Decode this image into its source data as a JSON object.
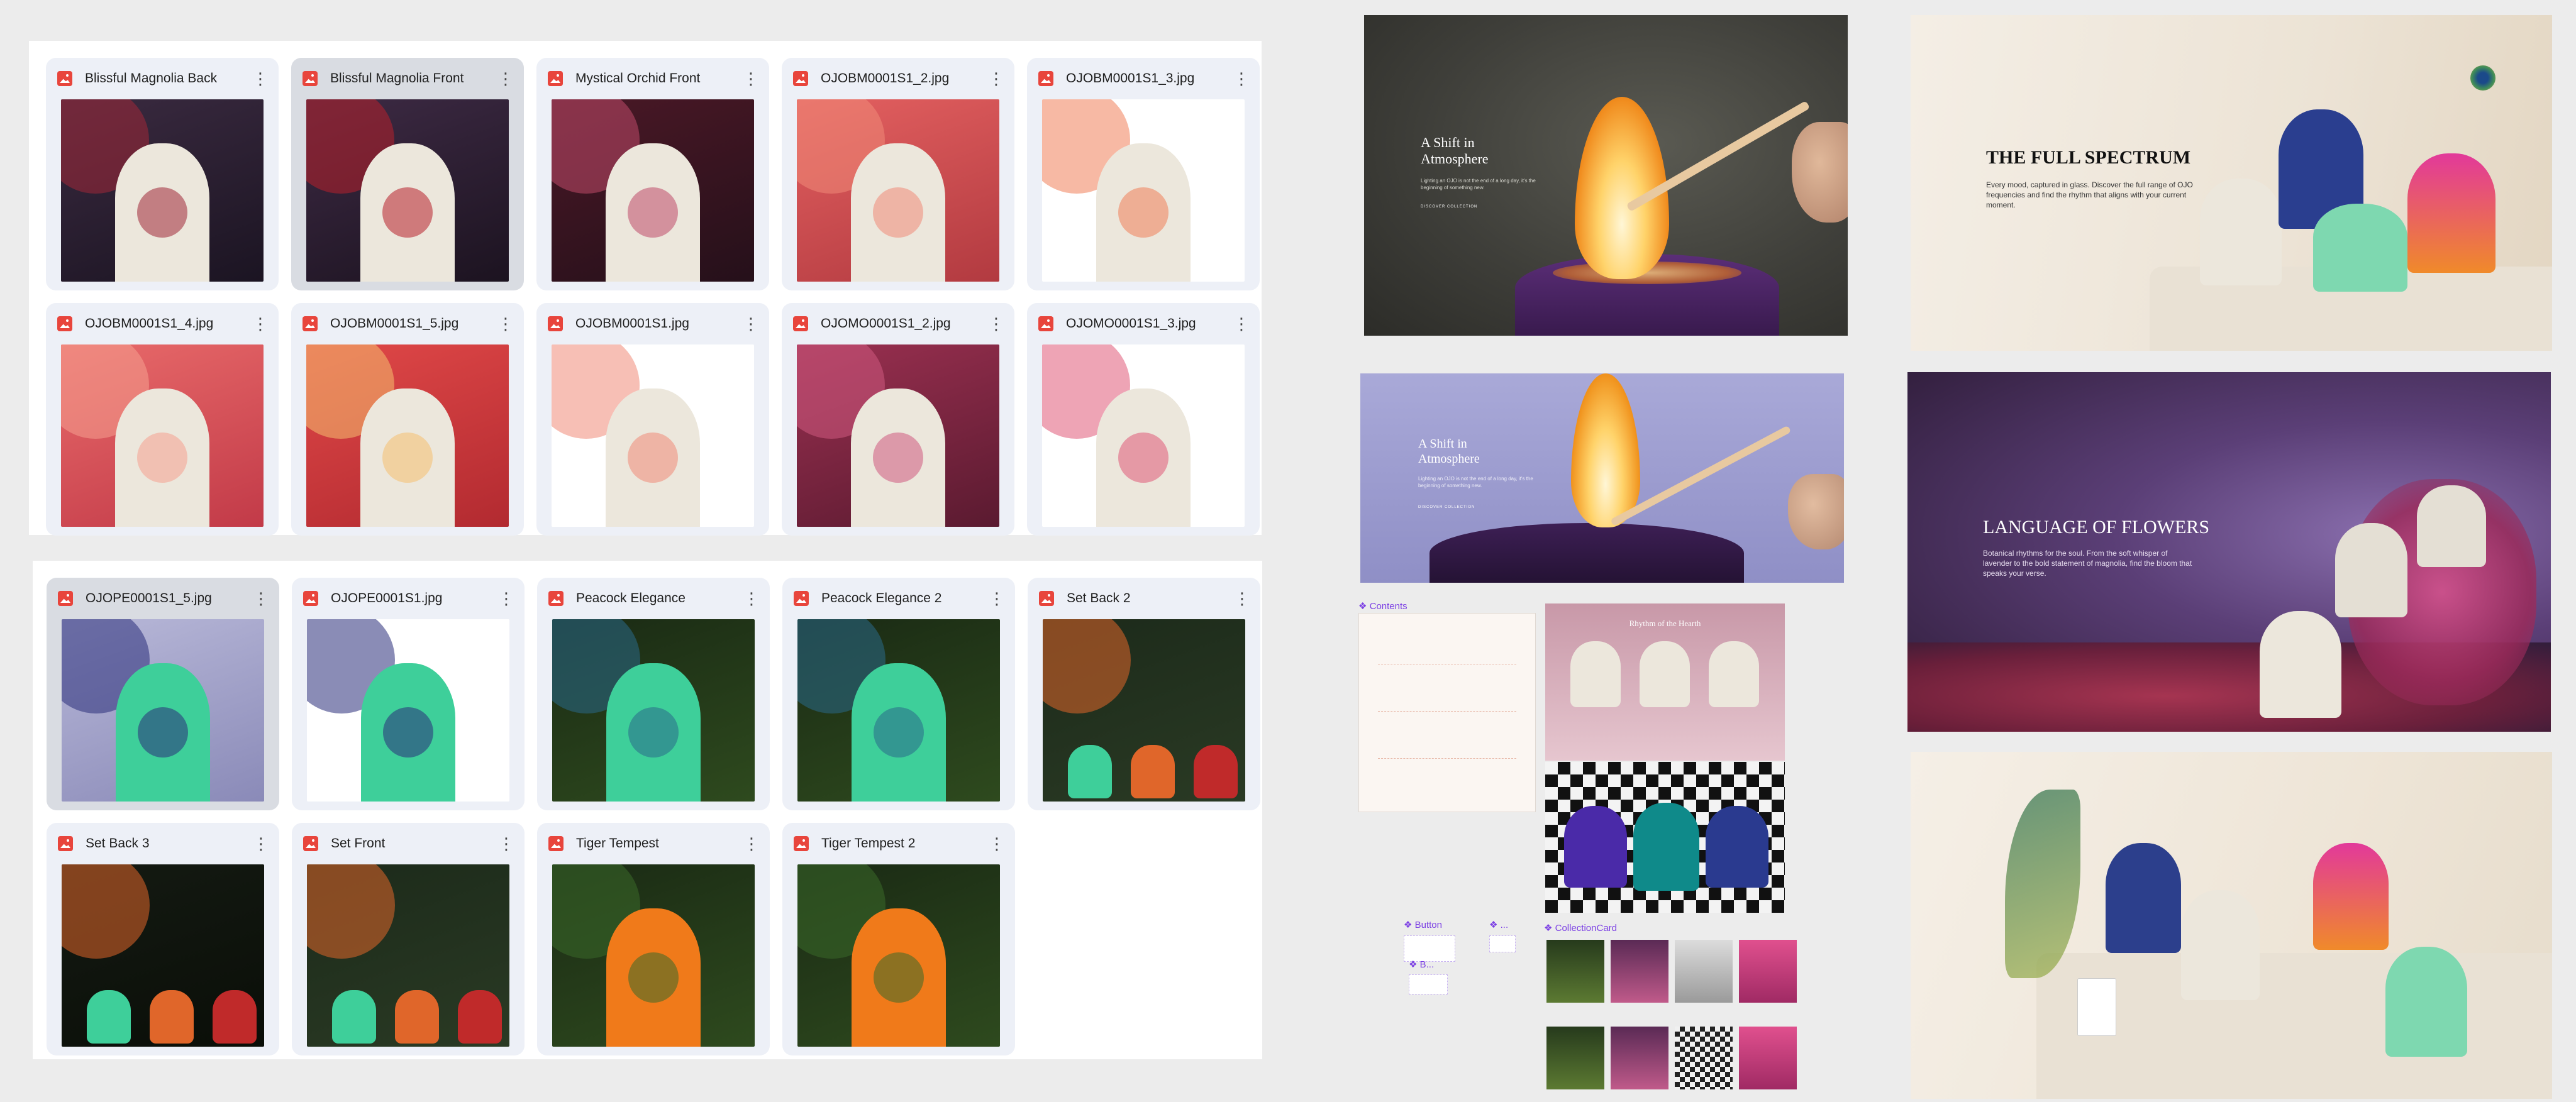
{
  "file_grid_top": {
    "cards": [
      {
        "name": "Blissful Magnolia Back",
        "selected": false,
        "subject": "cream candle jar with coral magnolia illustration on dark plum background"
      },
      {
        "name": "Blissful Magnolia Front",
        "selected": true,
        "subject": "cream candle jar labelled Blissful Magnolia with red flowers on dark background"
      },
      {
        "name": "Mystical Orchid Front",
        "selected": false,
        "subject": "cream candle jar labelled Mystical Orchid with pink orchids"
      },
      {
        "name": "OJOBM0001S1_2.jpg",
        "selected": false,
        "subject": "Blissful Magnolia jar over coral petals"
      },
      {
        "name": "OJOBM0001S1_3.jpg",
        "selected": false,
        "subject": "jar with coral magnolia line art on white"
      },
      {
        "name": "OJOBM0001S1_4.jpg",
        "selected": false,
        "subject": "jar with coral petals close-up"
      },
      {
        "name": "OJOBM0001S1_5.jpg",
        "selected": false,
        "subject": "lit candle on red background"
      },
      {
        "name": "OJOBM0001S1.jpg",
        "selected": false,
        "subject": "Blissful Magnolia jar on white"
      },
      {
        "name": "OJOMO0001S1_2.jpg",
        "selected": false,
        "subject": "Mystical Orchid jar with orchids"
      },
      {
        "name": "OJOMO0001S1_3.jpg",
        "selected": false,
        "subject": "jar with pink orchid line art on white"
      }
    ]
  },
  "file_grid_bottom": {
    "cards": [
      {
        "name": "OJOPE0001S1_5.jpg",
        "selected": true,
        "subject": "green lid and lit navy candle on lavender"
      },
      {
        "name": "OJOPE0001S1.jpg",
        "selected": false,
        "subject": "green Peacock Elegance jar on white"
      },
      {
        "name": "Peacock Elegance",
        "selected": false,
        "subject": "green jar in dark foliage with peacock feathers"
      },
      {
        "name": "Peacock Elegance 2",
        "selected": false,
        "subject": "green jar with peacock illustration in dark foliage"
      },
      {
        "name": "Set Back 2",
        "selected": false,
        "subject": "green, orange and red jars in dark greenery"
      },
      {
        "name": "Set Back 3",
        "selected": false,
        "subject": "orange, green and red jars on dark background"
      },
      {
        "name": "Set Front",
        "selected": false,
        "subject": "green, orange and red jars in greenery"
      },
      {
        "name": "Tiger Tempest",
        "selected": false,
        "subject": "orange Tiger Tempest jar in jungle"
      },
      {
        "name": "Tiger Tempest 2",
        "selected": false,
        "subject": "orange jar with tiger illustration in jungle"
      }
    ]
  },
  "artboards": {
    "atmosphere_dark": {
      "title": "A Shift in Atmosphere",
      "body": "Lighting an OJO is not the end of a long day, it's the beginning of something new.",
      "link": "DISCOVER COLLECTION"
    },
    "atmosphere_light": {
      "title": "A Shift in Atmosphere",
      "body": "Lighting an OJO is not the end of a long day, it's the beginning of something new.",
      "link": "DISCOVER COLLECTION"
    },
    "full_spectrum": {
      "title": "THE FULL SPECTRUM",
      "body": "Every mood, captured in glass. Discover the full range of OJO frequencies and find the rhythm that aligns with your current moment."
    },
    "language_of_flowers": {
      "title": "LANGUAGE OF FLOWERS",
      "body": "Botanical rhythms for the soul. From the soft whisper of lavender to the bold statement of magnolia, find the bloom that speaks your verse."
    },
    "hearth": {
      "title": "Rhythm of the Hearth"
    },
    "contents_label": "Contents",
    "button_label": "Button",
    "small_label_1": "B...",
    "small_label_2": "...",
    "collection_card_label": "CollectionCard"
  },
  "colors": {
    "card_bg": "#edf0f7",
    "card_selected_bg": "#d9dce2",
    "file_icon_red": "#e8453c",
    "figma_component_purple": "#7b3fe4"
  }
}
